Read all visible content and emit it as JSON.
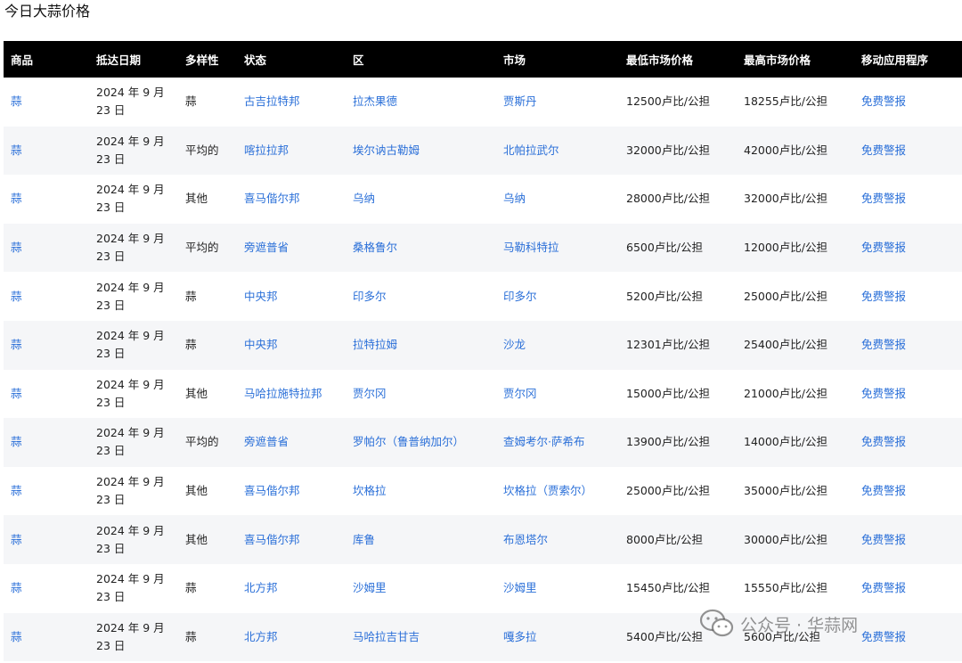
{
  "page_title": "今日大蒜价格",
  "table": {
    "headers": [
      "商品",
      "抵达日期",
      "多样性",
      "状态",
      "区",
      "市场",
      "最低市场价格",
      "最高市场价格",
      "移动应用程序"
    ],
    "rows": [
      {
        "commodity": "蒜",
        "date_line1": "2024 年 9 月",
        "date_line2": "23 日",
        "variety": "蒜",
        "state": "古吉拉特邦",
        "district": "拉杰果德",
        "market": "贾斯丹",
        "min_price": "12500卢比/公担",
        "max_price": "18255卢比/公担",
        "app": "免费警报"
      },
      {
        "commodity": "蒜",
        "date_line1": "2024 年 9 月",
        "date_line2": "23 日",
        "variety": "平均的",
        "state": "喀拉拉邦",
        "district": "埃尔讷古勒姆",
        "market": "北帕拉武尔",
        "min_price": "32000卢比/公担",
        "max_price": "42000卢比/公担",
        "app": "免费警报"
      },
      {
        "commodity": "蒜",
        "date_line1": "2024 年 9 月",
        "date_line2": "23 日",
        "variety": "其他",
        "state": "喜马偕尔邦",
        "district": "乌纳",
        "market": "乌纳",
        "min_price": "28000卢比/公担",
        "max_price": "32000卢比/公担",
        "app": "免费警报"
      },
      {
        "commodity": "蒜",
        "date_line1": "2024 年 9 月",
        "date_line2": "23 日",
        "variety": "平均的",
        "state": "旁遮普省",
        "district": "桑格鲁尔",
        "market": "马勒科特拉",
        "min_price": "6500卢比/公担",
        "max_price": "12000卢比/公担",
        "app": "免费警报"
      },
      {
        "commodity": "蒜",
        "date_line1": "2024 年 9 月",
        "date_line2": "23 日",
        "variety": "蒜",
        "state": "中央邦",
        "district": "印多尔",
        "market": "印多尔",
        "min_price": "5200卢比/公担",
        "max_price": "25000卢比/公担",
        "app": "免费警报"
      },
      {
        "commodity": "蒜",
        "date_line1": "2024 年 9 月",
        "date_line2": "23 日",
        "variety": "蒜",
        "state": "中央邦",
        "district": "拉特拉姆",
        "market": "沙龙",
        "min_price": "12301卢比/公担",
        "max_price": "25400卢比/公担",
        "app": "免费警报"
      },
      {
        "commodity": "蒜",
        "date_line1": "2024 年 9 月",
        "date_line2": "23 日",
        "variety": "其他",
        "state": "马哈拉施特拉邦",
        "district": "贾尔冈",
        "market": "贾尔冈",
        "min_price": "15000卢比/公担",
        "max_price": "21000卢比/公担",
        "app": "免费警报"
      },
      {
        "commodity": "蒜",
        "date_line1": "2024 年 9 月",
        "date_line2": "23 日",
        "variety": "平均的",
        "state": "旁遮普省",
        "district": "罗帕尔（鲁普纳加尔）",
        "market": "查姆考尔·萨希布",
        "min_price": "13900卢比/公担",
        "max_price": "14000卢比/公担",
        "app": "免费警报"
      },
      {
        "commodity": "蒜",
        "date_line1": "2024 年 9 月",
        "date_line2": "23 日",
        "variety": "其他",
        "state": "喜马偕尔邦",
        "district": "坎格拉",
        "market": "坎格拉（贾索尔）",
        "min_price": "25000卢比/公担",
        "max_price": "35000卢比/公担",
        "app": "免费警报"
      },
      {
        "commodity": "蒜",
        "date_line1": "2024 年 9 月",
        "date_line2": "23 日",
        "variety": "其他",
        "state": "喜马偕尔邦",
        "district": "库鲁",
        "market": "布恩塔尔",
        "min_price": "8000卢比/公担",
        "max_price": "30000卢比/公担",
        "app": "免费警报"
      },
      {
        "commodity": "蒜",
        "date_line1": "2024 年 9 月",
        "date_line2": "23 日",
        "variety": "蒜",
        "state": "北方邦",
        "district": "沙姆里",
        "market": "沙姆里",
        "min_price": "15450卢比/公担",
        "max_price": "15550卢比/公担",
        "app": "免费警报"
      },
      {
        "commodity": "蒜",
        "date_line1": "2024 年 9 月",
        "date_line2": "23 日",
        "variety": "蒜",
        "state": "北方邦",
        "district": "马哈拉吉甘吉",
        "market": "嘎多拉",
        "min_price": "5400卢比/公担",
        "max_price": "5600卢比/公担",
        "app": "免费警报"
      }
    ]
  },
  "watermark": {
    "text": "公众号 · 华蒜网",
    "icon": "wechat-icon"
  },
  "colors": {
    "header_bg": "#000000",
    "link": "#2a6fd8",
    "row_alt": "#f5f6f8"
  }
}
